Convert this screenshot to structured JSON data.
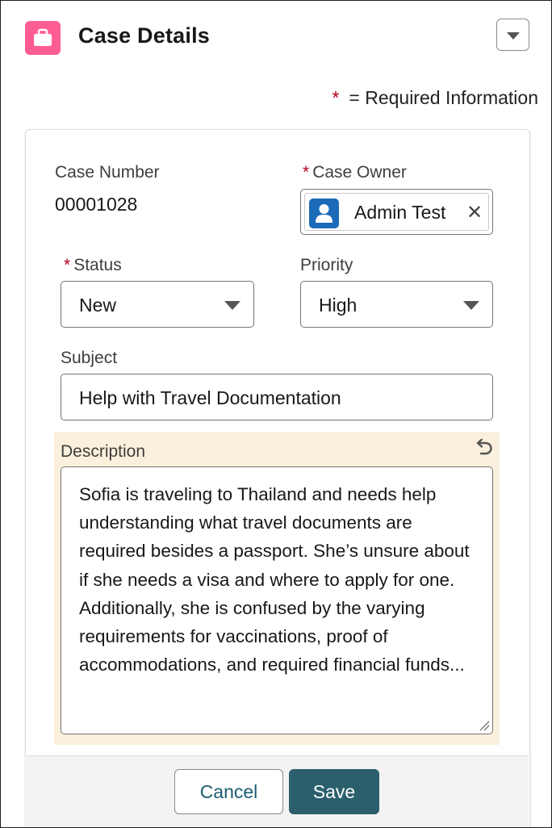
{
  "header": {
    "title": "Case Details",
    "icon": "briefcase-icon",
    "icon_color": "#fe5c94",
    "menu_icon": "chevron-down-icon"
  },
  "required_note": {
    "symbol": "*",
    "text": "= Required Information",
    "symbol_color": "#b5001f"
  },
  "form": {
    "case_number": {
      "label": "Case Number",
      "value": "00001028"
    },
    "case_owner": {
      "required_symbol": "*",
      "label": "Case Owner",
      "value": "Admin Test",
      "avatar_icon": "user-icon",
      "clear_icon": "close-icon"
    },
    "status": {
      "required_symbol": "*",
      "label": "Status",
      "value": "New"
    },
    "priority": {
      "label": "Priority",
      "value": "High"
    },
    "subject": {
      "label": "Subject",
      "value": "Help with Travel Documentation"
    },
    "description": {
      "label": "Description",
      "undo_icon": "undo-icon",
      "value": "Sofia is traveling to Thailand and needs help understanding what travel documents are required besides a passport. She’s unsure about if she needs a visa and where to apply for one. Additionally, she is confused by the varying requirements for vaccinations, proof of accommodations, and required financial funds...",
      "highlight_color": "#faf0dc"
    }
  },
  "footer": {
    "cancel_label": "Cancel",
    "save_label": "Save",
    "save_color": "#2b5f6c"
  }
}
